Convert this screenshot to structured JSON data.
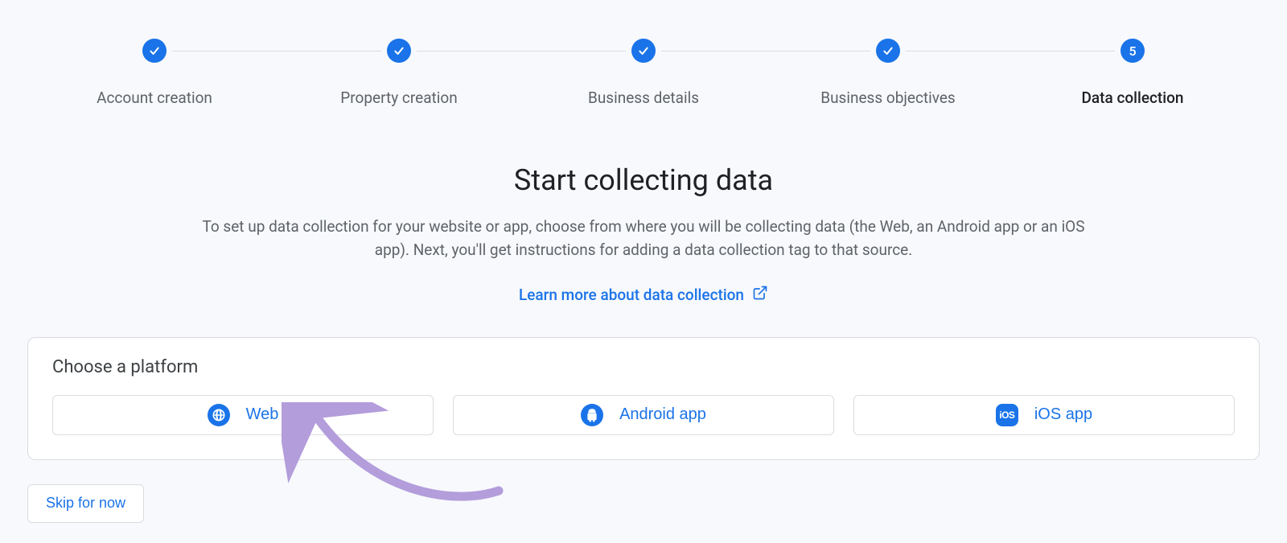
{
  "stepper": {
    "steps": [
      {
        "label": "Account creation",
        "state": "done",
        "indicator": "check"
      },
      {
        "label": "Property creation",
        "state": "done",
        "indicator": "check"
      },
      {
        "label": "Business details",
        "state": "done",
        "indicator": "check"
      },
      {
        "label": "Business objectives",
        "state": "done",
        "indicator": "check"
      },
      {
        "label": "Data collection",
        "state": "active",
        "indicator": "5"
      }
    ]
  },
  "hero": {
    "title": "Start collecting data",
    "description": "To set up data collection for your website or app, choose from where you will be collecting data (the Web, an Android app or an iOS app). Next, you'll get instructions for adding a data collection tag to that source.",
    "learn_more_label": "Learn more about data collection"
  },
  "card": {
    "title": "Choose a platform",
    "platforms": [
      {
        "label": "Web",
        "icon": "globe-icon"
      },
      {
        "label": "Android app",
        "icon": "android-icon"
      },
      {
        "label": "iOS app",
        "icon": "ios-icon",
        "badge_text": "iOS"
      }
    ]
  },
  "skip_label": "Skip for now",
  "annotation": {
    "arrow_target": "platform-web",
    "color": "#b39ddb"
  }
}
